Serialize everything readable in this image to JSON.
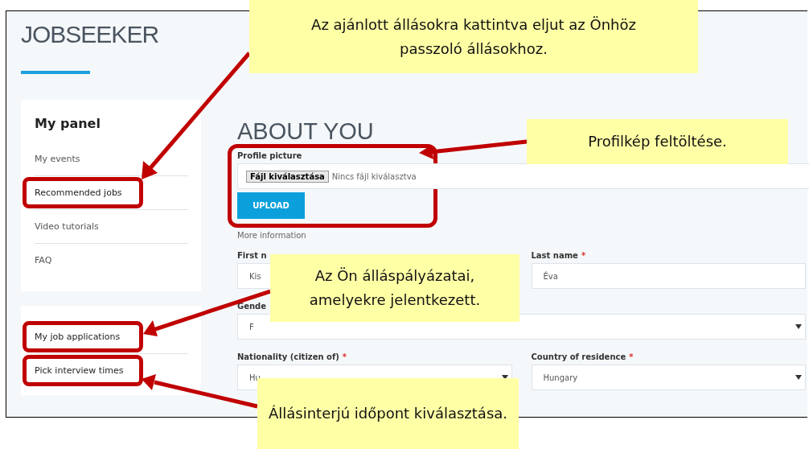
{
  "app": {
    "logo": "JOBSEEKER"
  },
  "sidebar": {
    "title": "My panel",
    "items": [
      {
        "label": "My events",
        "highlighted": false
      },
      {
        "label": "Recommended jobs",
        "highlighted": true
      },
      {
        "label": "Video tutorials",
        "highlighted": false
      },
      {
        "label": "FAQ",
        "highlighted": false
      }
    ],
    "items_2": [
      {
        "label": "My job applications",
        "highlighted": true
      },
      {
        "label": "Pick interview times",
        "highlighted": true
      }
    ]
  },
  "form": {
    "title": "ABOUT YOU",
    "profile_label": "Profile picture",
    "file_button": "Fájl kiválasztása",
    "file_status": "Nincs fájl kiválasztva",
    "upload_button": "UPLOAD",
    "section": "More information",
    "rows": [
      {
        "fields": [
          {
            "label": "First n",
            "value": "Kis",
            "kind": "text"
          },
          {
            "label": "Last name",
            "required_mark": "*",
            "value": "Éva",
            "kind": "text"
          }
        ]
      },
      {
        "fields": [
          {
            "label": "Gende",
            "value": "F",
            "kind": "select"
          }
        ]
      },
      {
        "fields": [
          {
            "label": "Nationality (citizen of)",
            "required_mark": "*",
            "value": "Hu",
            "kind": "select"
          },
          {
            "label": "Country of residence",
            "required_mark": "*",
            "value": "Hungary",
            "kind": "select"
          }
        ]
      }
    ]
  },
  "callouts": [
    {
      "text": "Az ajánlott állásokra kattintva eljut az Önhöz passzoló állásokhoz."
    },
    {
      "text": "Profilkép feltöltése."
    },
    {
      "text": "Az Ön álláspályázatai, amelyekre jelentkezett."
    },
    {
      "text": "Állásinterjú időpont kiválasztása."
    }
  ]
}
